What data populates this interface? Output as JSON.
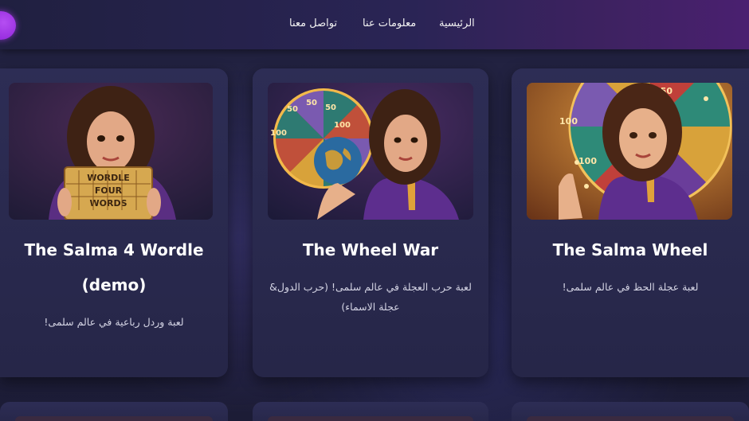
{
  "nav": {
    "home": "الرئيسية",
    "about": "معلومات عنا",
    "contact": "تواصل معنا"
  },
  "cards": [
    {
      "title": "The Salma Wheel",
      "description": "لعبة عجلة الحظ في عالم سلمى!",
      "image": "salma-wheel-image"
    },
    {
      "title": "The Wheel War",
      "description": "لعبة حرب العجلة في عالم سلمى! (حرب الدول& عجلة الاسماء)",
      "image": "wheel-war-image"
    },
    {
      "title": "The Salma 4 Wordle (demo)",
      "description": "لعبة وردل رباعية في عالم سلمى!",
      "image": "salma-wordle-image",
      "tiles": [
        "WORDLE",
        "FOUR",
        "WORDS"
      ]
    }
  ],
  "wheel_numbers": [
    "50",
    "50",
    "50",
    "100",
    "100"
  ],
  "colors": {
    "accent": "#8a1fd6",
    "card_bg": "#2b2b50",
    "page_bg": "#1e1e38"
  }
}
